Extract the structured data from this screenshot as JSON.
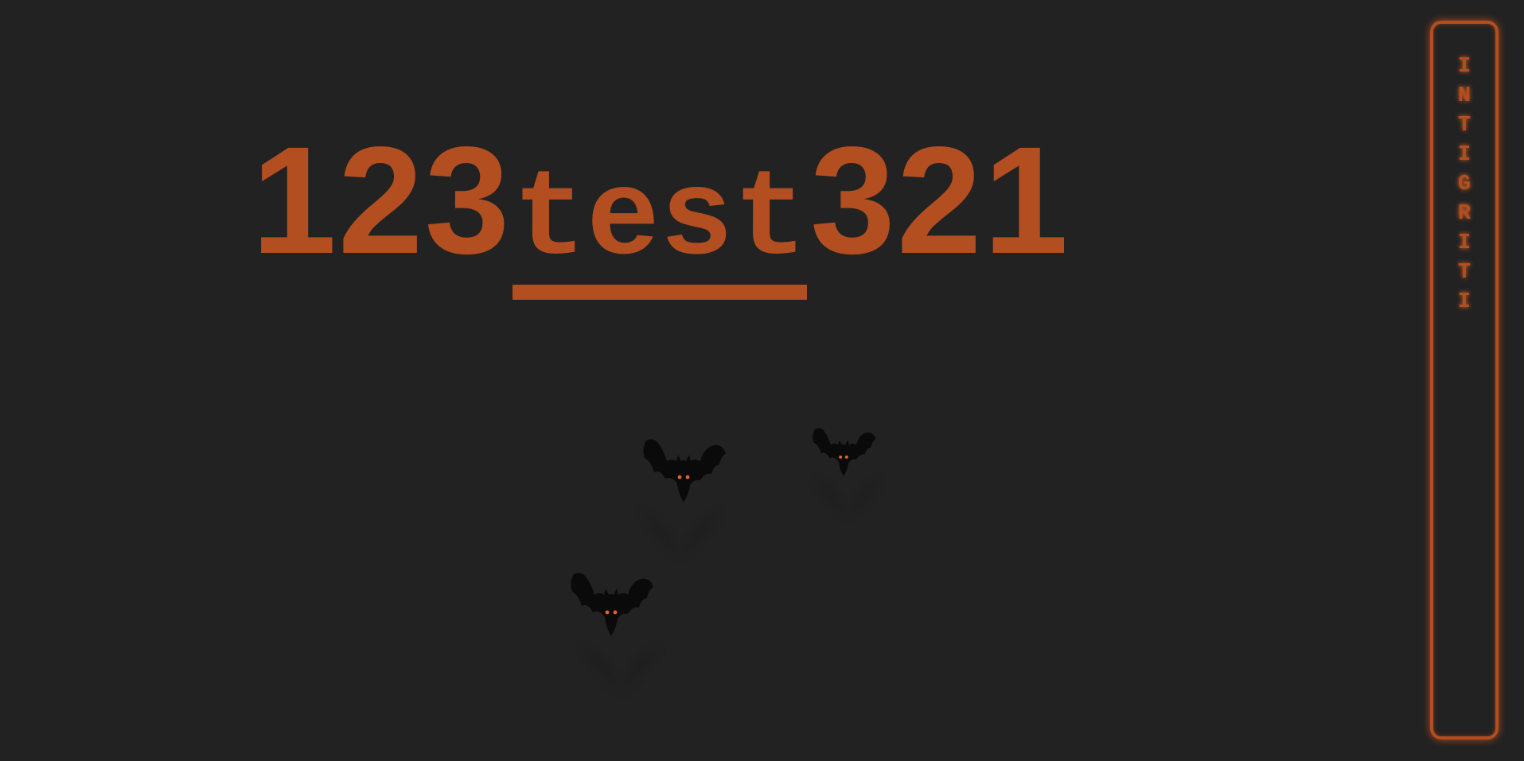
{
  "heading": {
    "prefix": "123",
    "word": "test",
    "suffix": "321"
  },
  "side_panel": {
    "letters": [
      "I",
      "N",
      "T",
      "I",
      "G",
      "R",
      "I",
      "T",
      "I"
    ]
  },
  "colors": {
    "background": "#222222",
    "accent": "#b34e20",
    "bat": "#0a0a0a",
    "bat_eyes": "#e0642a"
  },
  "decorations": {
    "icons": [
      "bat-icon",
      "bat-icon",
      "bat-icon"
    ]
  }
}
